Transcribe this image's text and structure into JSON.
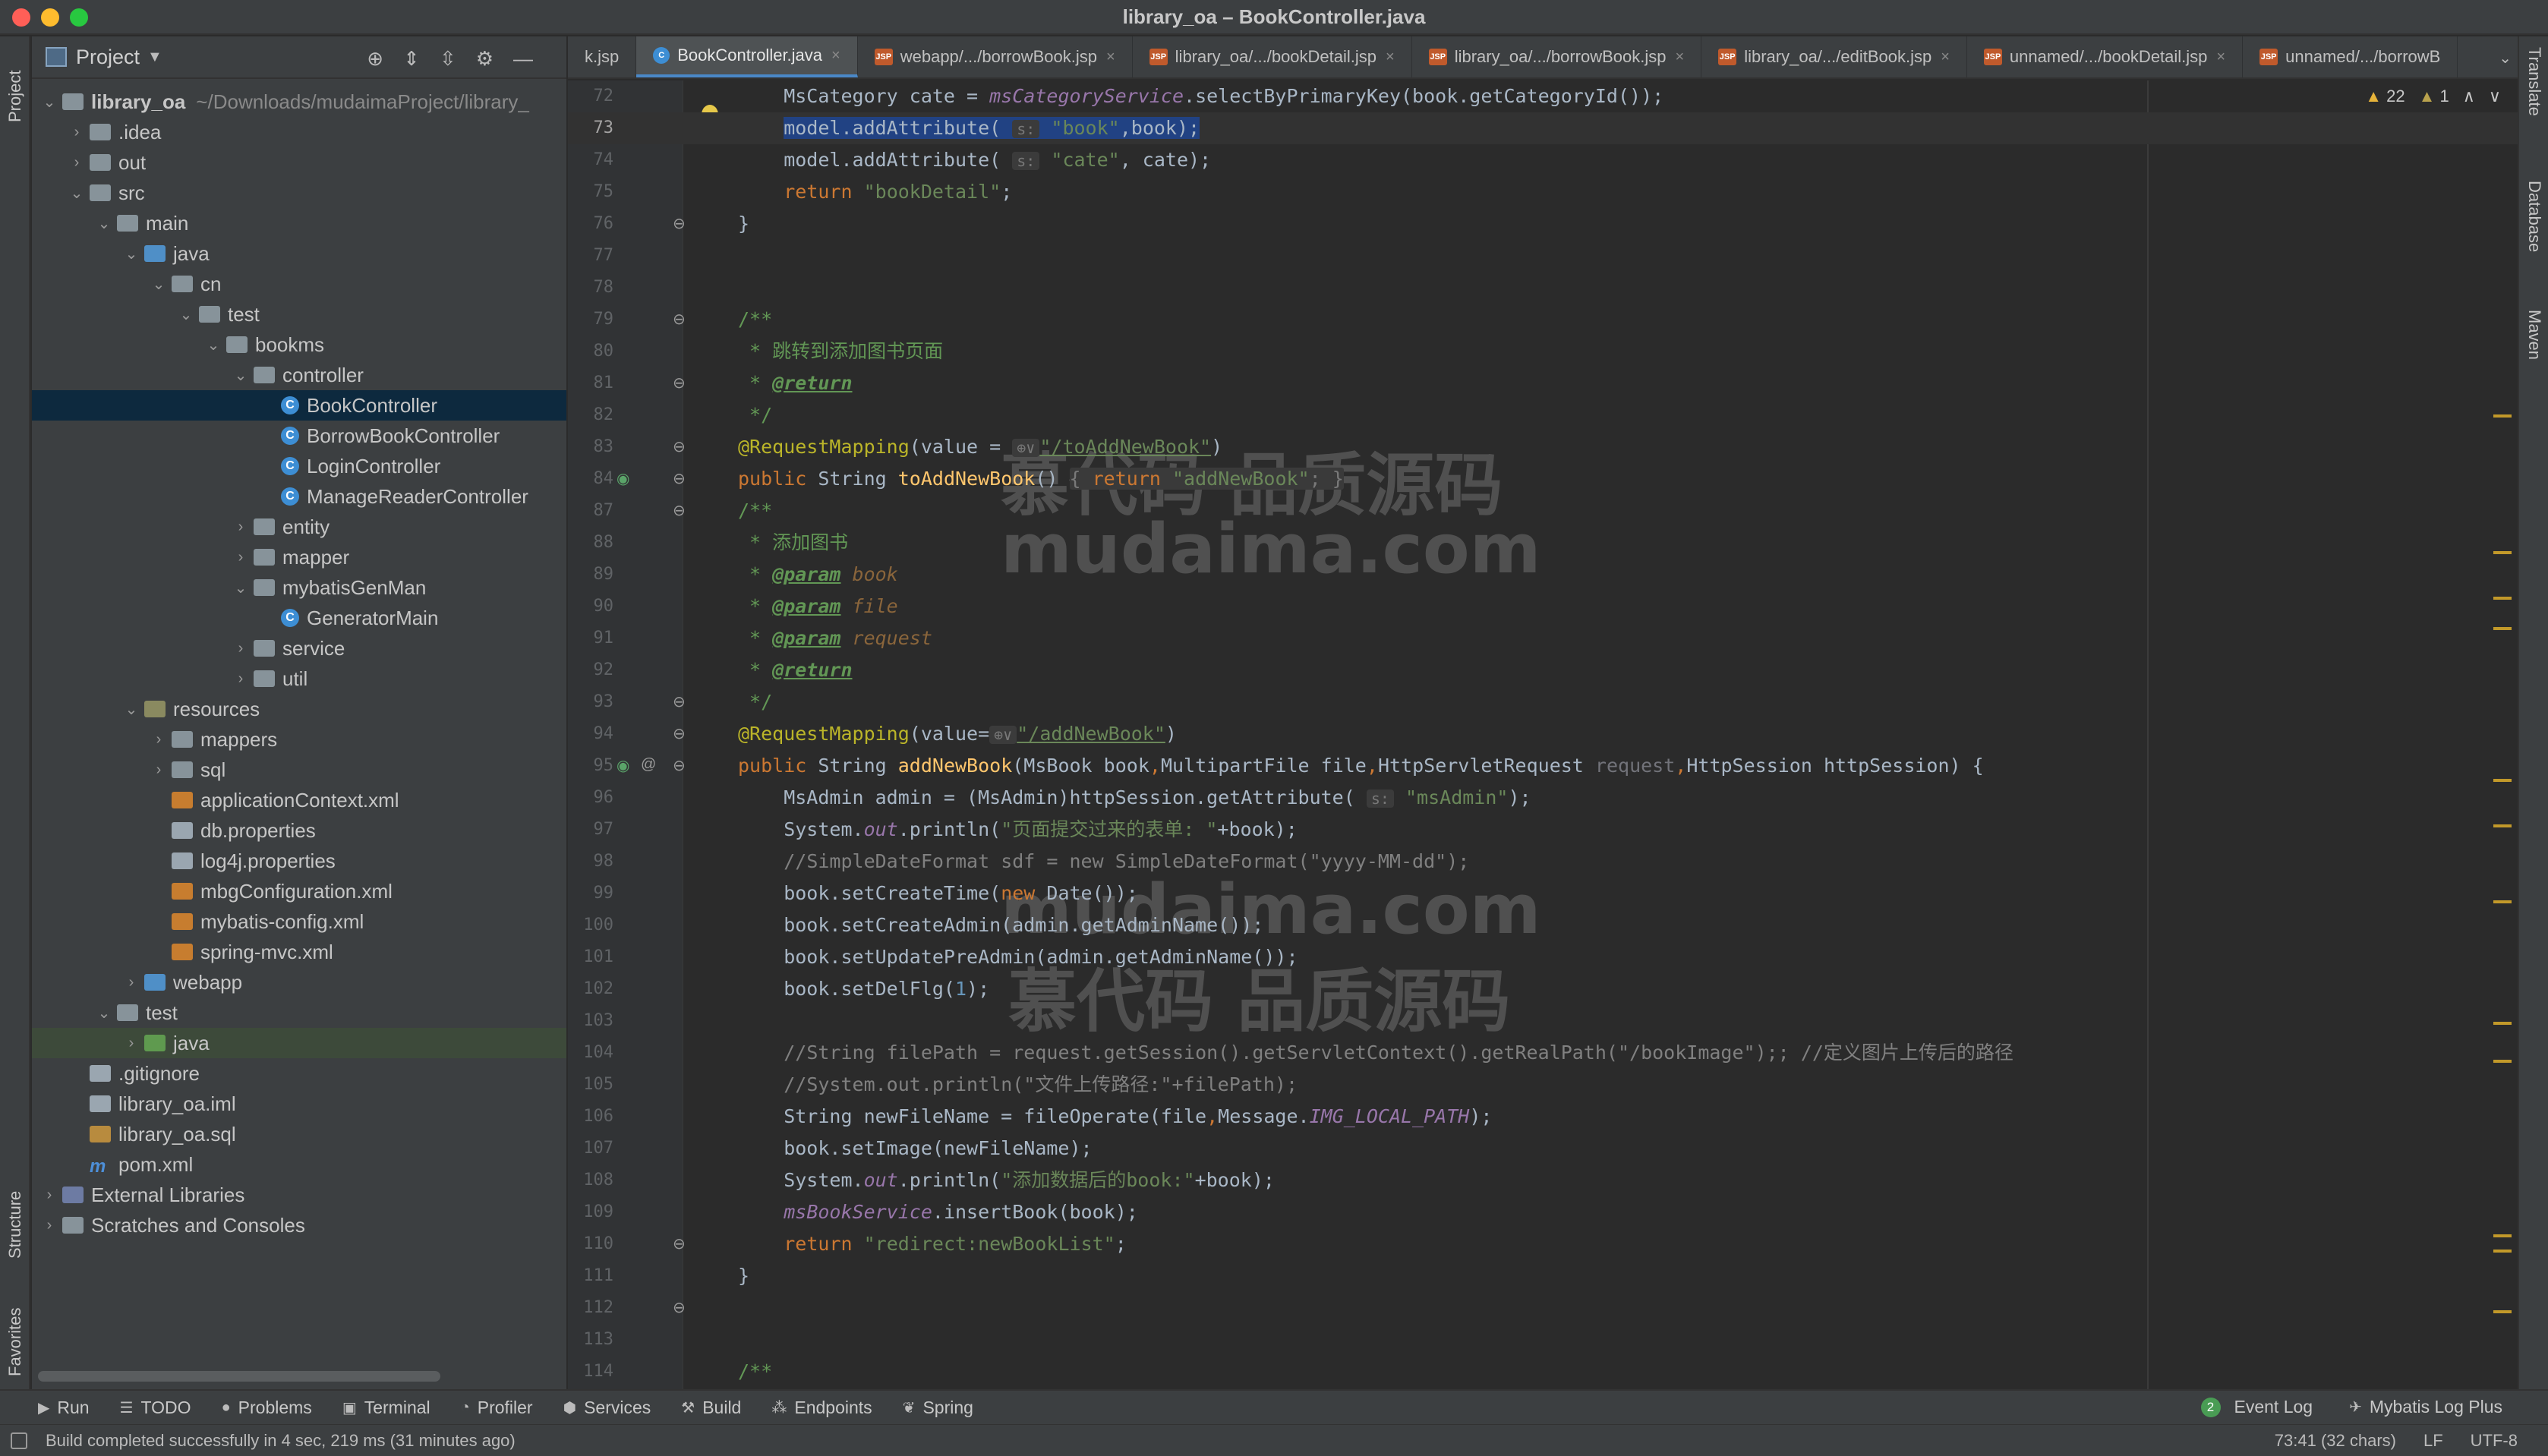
{
  "window": {
    "title": "library_oa – BookController.java"
  },
  "left_stripe": {
    "project": "Project",
    "structure": "Structure",
    "favorites": "Favorites"
  },
  "right_stripe": {
    "translate": "Translate",
    "database": "Database",
    "maven": "Maven"
  },
  "project_panel": {
    "title": "Project",
    "tree": [
      {
        "label": "library_oa",
        "extra": "~/Downloads/mudaimaProject/library_",
        "depth": 0,
        "arrow": "v",
        "icon": "folder",
        "bold": true
      },
      {
        "label": ".idea",
        "depth": 1,
        "arrow": ">",
        "icon": "folder"
      },
      {
        "label": "out",
        "depth": 1,
        "arrow": ">",
        "icon": "folder"
      },
      {
        "label": "src",
        "depth": 1,
        "arrow": "v",
        "icon": "folder"
      },
      {
        "label": "main",
        "depth": 2,
        "arrow": "v",
        "icon": "folder"
      },
      {
        "label": "java",
        "depth": 3,
        "arrow": "v",
        "icon": "src"
      },
      {
        "label": "cn",
        "depth": 4,
        "arrow": "v",
        "icon": "folder"
      },
      {
        "label": "test",
        "depth": 5,
        "arrow": "v",
        "icon": "folder"
      },
      {
        "label": "bookms",
        "depth": 6,
        "arrow": "v",
        "icon": "folder"
      },
      {
        "label": "controller",
        "depth": 7,
        "arrow": "v",
        "icon": "folder"
      },
      {
        "label": "BookController",
        "depth": 8,
        "arrow": "",
        "icon": "class",
        "selected": true
      },
      {
        "label": "BorrowBookController",
        "depth": 8,
        "arrow": "",
        "icon": "class"
      },
      {
        "label": "LoginController",
        "depth": 8,
        "arrow": "",
        "icon": "class"
      },
      {
        "label": "ManageReaderController",
        "depth": 8,
        "arrow": "",
        "icon": "class"
      },
      {
        "label": "entity",
        "depth": 7,
        "arrow": ">",
        "icon": "folder"
      },
      {
        "label": "mapper",
        "depth": 7,
        "arrow": ">",
        "icon": "folder"
      },
      {
        "label": "mybatisGenMan",
        "depth": 7,
        "arrow": "v",
        "icon": "folder"
      },
      {
        "label": "GeneratorMain",
        "depth": 8,
        "arrow": "",
        "icon": "class"
      },
      {
        "label": "service",
        "depth": 7,
        "arrow": ">",
        "icon": "folder"
      },
      {
        "label": "util",
        "depth": 7,
        "arrow": ">",
        "icon": "folder"
      },
      {
        "label": "resources",
        "depth": 3,
        "arrow": "v",
        "icon": "res"
      },
      {
        "label": "mappers",
        "depth": 4,
        "arrow": ">",
        "icon": "folder"
      },
      {
        "label": "sql",
        "depth": 4,
        "arrow": ">",
        "icon": "folder"
      },
      {
        "label": "applicationContext.xml",
        "depth": 4,
        "arrow": "",
        "icon": "xml"
      },
      {
        "label": "db.properties",
        "depth": 4,
        "arrow": "",
        "icon": "file"
      },
      {
        "label": "log4j.properties",
        "depth": 4,
        "arrow": "",
        "icon": "file"
      },
      {
        "label": "mbgConfiguration.xml",
        "depth": 4,
        "arrow": "",
        "icon": "xml"
      },
      {
        "label": "mybatis-config.xml",
        "depth": 4,
        "arrow": "",
        "icon": "xml"
      },
      {
        "label": "spring-mvc.xml",
        "depth": 4,
        "arrow": "",
        "icon": "xml"
      },
      {
        "label": "webapp",
        "depth": 3,
        "arrow": ">",
        "icon": "src"
      },
      {
        "label": "test",
        "depth": 2,
        "arrow": "v",
        "icon": "folder"
      },
      {
        "label": "java",
        "depth": 3,
        "arrow": ">",
        "icon": "test",
        "selected2": true
      },
      {
        "label": ".gitignore",
        "depth": 1,
        "arrow": "",
        "icon": "file"
      },
      {
        "label": "library_oa.iml",
        "depth": 1,
        "arrow": "",
        "icon": "file"
      },
      {
        "label": "library_oa.sql",
        "depth": 1,
        "arrow": "",
        "icon": "sql"
      },
      {
        "label": "pom.xml",
        "depth": 1,
        "arrow": "",
        "icon": "maven"
      },
      {
        "label": "External Libraries",
        "depth": 0,
        "arrow": ">",
        "icon": "lib"
      },
      {
        "label": "Scratches and Consoles",
        "depth": 0,
        "arrow": ">",
        "icon": "folder"
      }
    ]
  },
  "tabs": [
    {
      "label": "k.jsp",
      "icon": "jsp",
      "active": false,
      "closable": false
    },
    {
      "label": "BookController.java",
      "icon": "java",
      "active": true,
      "closable": true
    },
    {
      "label": "webapp/.../borrowBook.jsp",
      "icon": "jsp",
      "active": false,
      "closable": true
    },
    {
      "label": "library_oa/.../bookDetail.jsp",
      "icon": "jsp",
      "active": false,
      "closable": true
    },
    {
      "label": "library_oa/.../borrowBook.jsp",
      "icon": "jsp",
      "active": false,
      "closable": true
    },
    {
      "label": "library_oa/.../editBook.jsp",
      "icon": "jsp",
      "active": false,
      "closable": true
    },
    {
      "label": "unnamed/.../bookDetail.jsp",
      "icon": "jsp",
      "active": false,
      "closable": true
    },
    {
      "label": "unnamed/.../borrowB",
      "icon": "jsp",
      "active": false,
      "closable": false
    }
  ],
  "editor": {
    "warnings": "22",
    "weak_warnings": "1",
    "lines": [
      {
        "n": "72",
        "html": "    MsCategory cate = <span class=\"fld\">msCategoryService</span>.selectByPrimaryKey(book.getCategoryId());"
      },
      {
        "n": "73",
        "html": "    <span class=\"selhl\">model.addAttribute( <span class=\"hint\">s:</span> <span class=\"str\">\"book\"</span>,book);</span>",
        "current": true
      },
      {
        "n": "74",
        "html": "    model.addAttribute( <span class=\"hint\">s:</span> <span class=\"str\">\"cate\"</span>, cate);"
      },
      {
        "n": "75",
        "html": "    <span class=\"kw\">return</span> <span class=\"str\">\"bookDetail\"</span>;"
      },
      {
        "n": "76",
        "html": "}"
      },
      {
        "n": "77",
        "html": ""
      },
      {
        "n": "78",
        "html": ""
      },
      {
        "n": "79",
        "html": "<span class=\"doc\">/**</span>"
      },
      {
        "n": "80",
        "html": "<span class=\"doc\"> * 跳转到添加图书页面</span>"
      },
      {
        "n": "81",
        "html": "<span class=\"doc\"> * </span><span class=\"doctag\">@return</span>"
      },
      {
        "n": "82",
        "html": "<span class=\"doc\"> */</span>"
      },
      {
        "n": "83",
        "html": "<span class=\"ann\">@RequestMapping</span>(value = <span class=\"hint\">⊕∨</span><span class=\"lnk\">\"/toAddNewBook\"</span>)"
      },
      {
        "n": "84",
        "html": "<span class=\"kw\">public</span> String <span class=\"fn\">toAddNewBook</span>() <span class=\"fold\">{ <span class=\"kw\">return</span> <span class=\"str\">\"addNewBook\"</span>; }</span>"
      },
      {
        "n": "87",
        "html": "<span class=\"doc\">/**</span>"
      },
      {
        "n": "88",
        "html": "<span class=\"doc\"> * 添加图书</span>"
      },
      {
        "n": "89",
        "html": "<span class=\"doc\"> * </span><span class=\"doctag\">@param</span> <span class=\"docval\">book</span>"
      },
      {
        "n": "90",
        "html": "<span class=\"doc\"> * </span><span class=\"doctag\">@param</span> <span class=\"docval\">file</span>"
      },
      {
        "n": "91",
        "html": "<span class=\"doc\"> * </span><span class=\"doctag\">@param</span> <span class=\"docval\">request</span>"
      },
      {
        "n": "92",
        "html": "<span class=\"doc\"> * </span><span class=\"doctag\">@return</span>"
      },
      {
        "n": "93",
        "html": "<span class=\"doc\"> */</span>"
      },
      {
        "n": "94",
        "html": "<span class=\"ann\">@RequestMapping</span>(value=<span class=\"hint\">⊕∨</span><span class=\"lnk\">\"/addNewBook\"</span>)"
      },
      {
        "n": "95",
        "html": "<span class=\"kw\">public</span> String <span class=\"fn\">addNewBook</span>(MsBook book<span class=\"kw\">,</span>MultipartFile file<span class=\"kw\">,</span>HttpServletRequest <span class=\"dimparam\">request</span><span class=\"kw\">,</span>HttpSession httpSession) {"
      },
      {
        "n": "96",
        "html": "    MsAdmin admin = (MsAdmin)httpSession.getAttribute( <span class=\"hint\">s:</span> <span class=\"str\">\"msAdmin\"</span>);"
      },
      {
        "n": "97",
        "html": "    System.<span class=\"cst\">out</span>.println(<span class=\"str\">\"页面提交过来的表单: \"</span>+book);"
      },
      {
        "n": "98",
        "html": "    <span class=\"cmt\">//SimpleDateFormat sdf = new SimpleDateFormat(\"yyyy-MM-dd\");</span>"
      },
      {
        "n": "99",
        "html": "    book.setCreateTime(<span class=\"kw\">new</span> Date());"
      },
      {
        "n": "100",
        "html": "    book.setCreateAdmin(admin.getAdminName());"
      },
      {
        "n": "101",
        "html": "    book.setUpdatePreAdmin(admin.getAdminName());"
      },
      {
        "n": "102",
        "html": "    book.setDelFlg(<span class=\"num\">1</span>);"
      },
      {
        "n": "103",
        "html": ""
      },
      {
        "n": "104",
        "html": "    <span class=\"cmt\">//String filePath = request.getSession().getServletContext().getRealPath(\"/bookImage\");; //定义图片上传后的路径</span>"
      },
      {
        "n": "105",
        "html": "    <span class=\"cmt\">//System.out.println(\"文件上传路径:\"+filePath);</span>"
      },
      {
        "n": "106",
        "html": "    String newFileName = fileOperate(file<span class=\"kw\">,</span>Message.<span class=\"cst\">IMG_LOCAL_PATH</span>);"
      },
      {
        "n": "107",
        "html": "    book.setImage(newFileName);"
      },
      {
        "n": "108",
        "html": "    System.<span class=\"cst\">out</span>.println(<span class=\"str\">\"添加数据后的book:\"</span>+book);"
      },
      {
        "n": "109",
        "html": "    <span class=\"fld\">msBookService</span>.insertBook(book);"
      },
      {
        "n": "110",
        "html": "    <span class=\"kw\">return</span> <span class=\"str\">\"redirect:newBookList\"</span>;"
      },
      {
        "n": "111",
        "html": "}"
      },
      {
        "n": "112",
        "html": ""
      },
      {
        "n": "113",
        "html": ""
      },
      {
        "n": "114",
        "html": "<span class=\"doc\">/**</span>"
      }
    ]
  },
  "watermarks": {
    "a_cn": "慕代码 品质源码",
    "a_en": "mudaima.com",
    "b_en": "mudaima.com",
    "b_cn": "慕代码 品质源码"
  },
  "bottom_toolbar": {
    "items": [
      "Run",
      "TODO",
      "Problems",
      "Terminal",
      "Profiler",
      "Services",
      "Build",
      "Endpoints",
      "Spring"
    ],
    "event_log_count": "2",
    "event_log": "Event Log",
    "mybatis": "Mybatis Log Plus"
  },
  "status": {
    "message": "Build completed successfully in 4 sec, 219 ms (31 minutes ago)",
    "position": "73:41 (32 chars)",
    "line_sep": "LF",
    "encoding": "UTF-8"
  },
  "colors": {
    "accent": "#4a88c7",
    "selection": "#214283",
    "tree_selection": "#0d293e"
  }
}
